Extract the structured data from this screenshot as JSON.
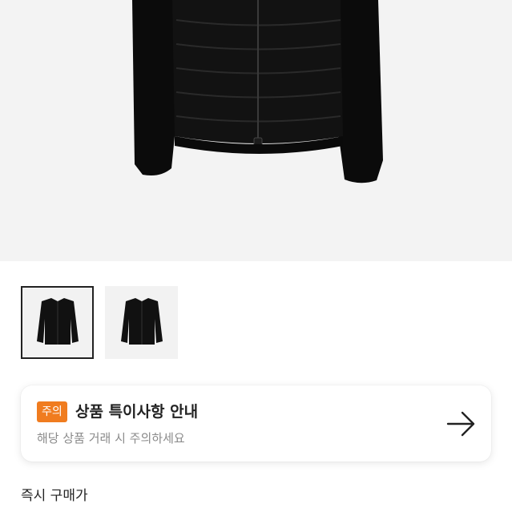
{
  "product": {
    "image_alt": "black padded jacket with knit sleeves",
    "thumbnails": [
      {
        "name": "front",
        "selected": true
      },
      {
        "name": "front-alt",
        "selected": false
      }
    ]
  },
  "notice": {
    "badge": "주의",
    "title": "상품 특이사항 안내",
    "subtitle": "해당 상품 거래 시 주의하세요",
    "arrow_icon": "arrow-right-icon",
    "badge_color": "#f07c1f"
  },
  "price_section": {
    "title": "즉시 구매가"
  }
}
